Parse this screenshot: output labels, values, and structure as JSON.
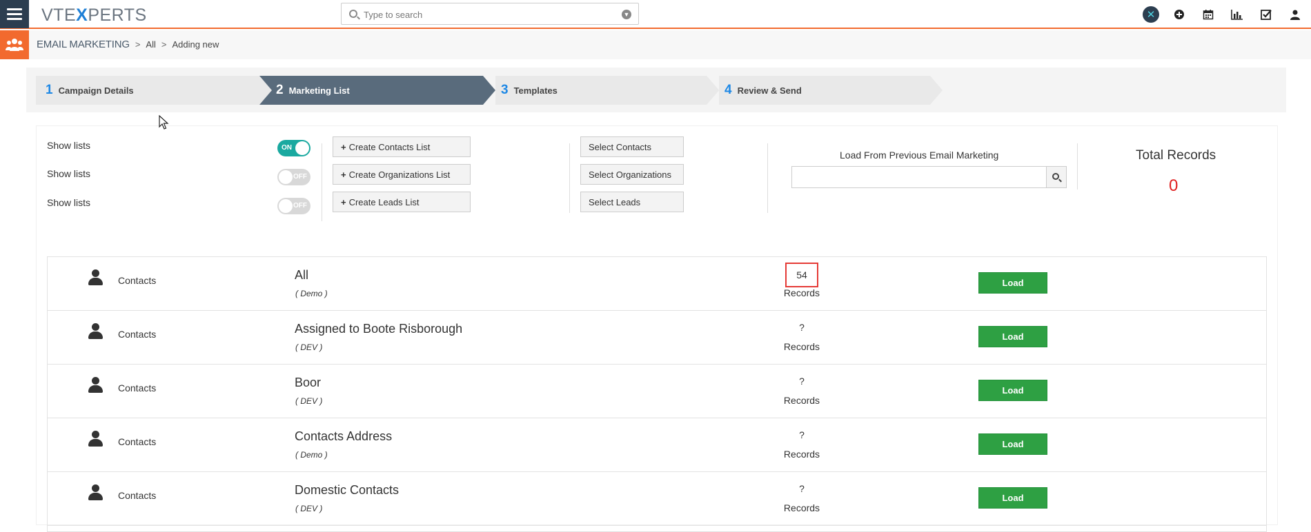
{
  "app": {
    "logo_part1": "VTE",
    "logo_x": "X",
    "logo_part2": "PERTS"
  },
  "search": {
    "placeholder": "Type to search"
  },
  "top_icons": [
    "vtexperts-x-icon",
    "plus-circle-icon",
    "calendar-icon",
    "bar-chart-icon",
    "checkbox-icon",
    "user-icon"
  ],
  "breadcrumb": {
    "module": "EMAIL MARKETING",
    "sep": ">",
    "level1": "All",
    "level2": "Adding new"
  },
  "wizard": {
    "steps": [
      {
        "num": "1",
        "label": "Campaign Details"
      },
      {
        "num": "2",
        "label": "Marketing List"
      },
      {
        "num": "3",
        "label": "Templates"
      },
      {
        "num": "4",
        "label": "Review & Send"
      }
    ],
    "active_step": 2
  },
  "controls": {
    "show_lists": [
      {
        "label": "Show lists",
        "state": "ON"
      },
      {
        "label": "Show lists",
        "state": "OFF"
      },
      {
        "label": "Show lists",
        "state": "OFF"
      }
    ],
    "create_buttons": [
      "Create Contacts List",
      "Create Organizations List",
      "Create Leads List"
    ],
    "select_buttons": [
      "Select Contacts",
      "Select Organizations",
      "Select Leads"
    ],
    "load_previous_label": "Load From Previous Email Marketing",
    "load_previous_value": "",
    "total_records_label": "Total Records",
    "total_records_value": "0"
  },
  "lists": [
    {
      "module": "Contacts",
      "name": "All",
      "owner": "( Demo )",
      "count": "54",
      "records_label": "Records",
      "action": "Load"
    },
    {
      "module": "Contacts",
      "name": "Assigned to Boote Risborough",
      "owner": "( DEV )",
      "count": "?",
      "records_label": "Records",
      "action": "Load"
    },
    {
      "module": "Contacts",
      "name": "Boor",
      "owner": "( DEV )",
      "count": "?",
      "records_label": "Records",
      "action": "Load"
    },
    {
      "module": "Contacts",
      "name": "Contacts Address",
      "owner": "( Demo )",
      "count": "?",
      "records_label": "Records",
      "action": "Load"
    },
    {
      "module": "Contacts",
      "name": "Domestic Contacts",
      "owner": "( DEV )",
      "count": "?",
      "records_label": "Records",
      "action": "Load"
    }
  ],
  "colors": {
    "accent_orange": "#f26a2e",
    "nav_dark": "#2c3e50",
    "active_step": "#596b7c",
    "toggle_on": "#1aa9a0",
    "load_green": "#2ea043",
    "total_red": "#e02020",
    "highlight_box": "#e53935"
  }
}
